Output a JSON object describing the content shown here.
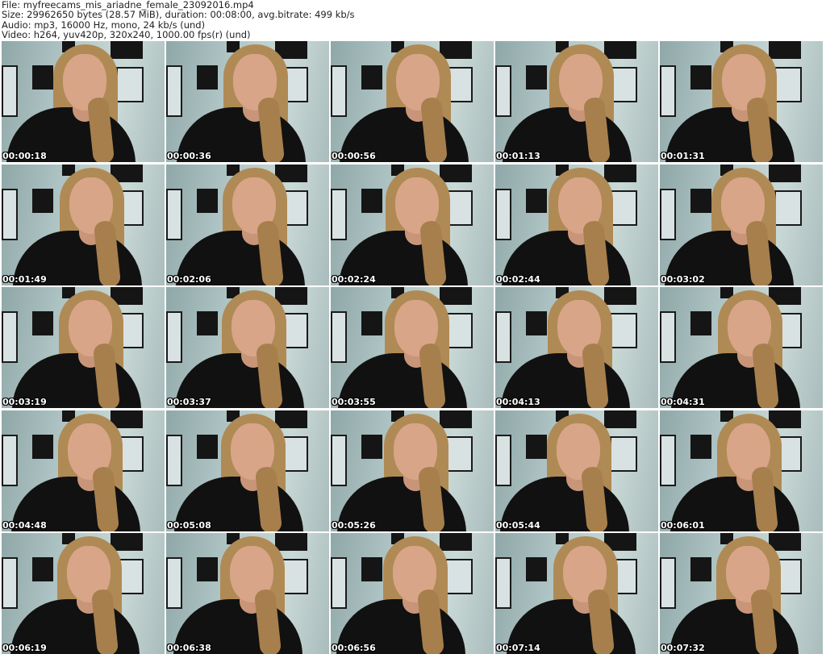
{
  "header": {
    "file": "File: myfreecams_mis_ariadne_female_23092016.mp4",
    "size": "Size: 29962650 bytes (28.57 MiB), duration: 00:08:00, avg.bitrate: 499 kb/s",
    "audio": "Audio: mp3, 16000 Hz, mono, 24 kb/s (und)",
    "video": "Video: h264, yuv420p, 320x240, 1000.00 fps(r) (und)"
  },
  "thumbnails": [
    "00:00:18",
    "00:00:36",
    "00:00:56",
    "00:01:13",
    "00:01:31",
    "00:01:49",
    "00:02:06",
    "00:02:24",
    "00:02:44",
    "00:03:02",
    "00:03:19",
    "00:03:37",
    "00:03:55",
    "00:04:13",
    "00:04:31",
    "00:04:48",
    "00:05:08",
    "00:05:26",
    "00:05:44",
    "00:06:01",
    "00:06:19",
    "00:06:38",
    "00:06:56",
    "00:07:14",
    "00:07:32"
  ]
}
